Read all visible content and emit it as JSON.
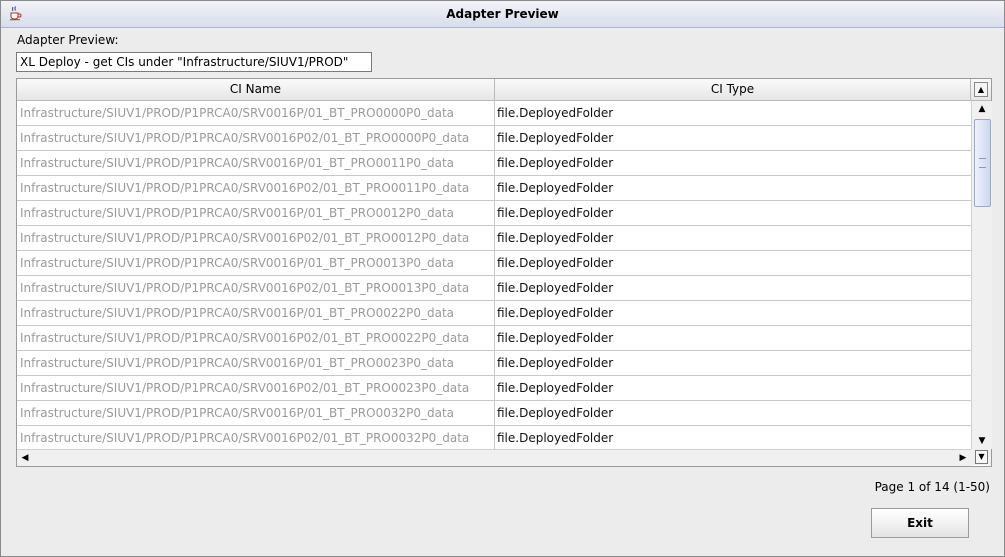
{
  "window": {
    "title": "Adapter Preview",
    "icon": "java-cup-icon"
  },
  "caption": "Adapter Preview:",
  "source_field": {
    "value": "XL Deploy - get CIs under \"Infrastructure/SIUV1/PROD\""
  },
  "table": {
    "columns": [
      "CI Name",
      "CI Type"
    ],
    "rows": [
      {
        "name": "Infrastructure/SIUV1/PROD/P1PRCA0/SRV0016P/01_BT_PRO0000P0_data",
        "type": "file.DeployedFolder"
      },
      {
        "name": "Infrastructure/SIUV1/PROD/P1PRCA0/SRV0016P02/01_BT_PRO0000P0_data",
        "type": "file.DeployedFolder"
      },
      {
        "name": "Infrastructure/SIUV1/PROD/P1PRCA0/SRV0016P/01_BT_PRO0011P0_data",
        "type": "file.DeployedFolder"
      },
      {
        "name": "Infrastructure/SIUV1/PROD/P1PRCA0/SRV0016P02/01_BT_PRO0011P0_data",
        "type": "file.DeployedFolder"
      },
      {
        "name": "Infrastructure/SIUV1/PROD/P1PRCA0/SRV0016P/01_BT_PRO0012P0_data",
        "type": "file.DeployedFolder"
      },
      {
        "name": "Infrastructure/SIUV1/PROD/P1PRCA0/SRV0016P02/01_BT_PRO0012P0_data",
        "type": "file.DeployedFolder"
      },
      {
        "name": "Infrastructure/SIUV1/PROD/P1PRCA0/SRV0016P/01_BT_PRO0013P0_data",
        "type": "file.DeployedFolder"
      },
      {
        "name": "Infrastructure/SIUV1/PROD/P1PRCA0/SRV0016P02/01_BT_PRO0013P0_data",
        "type": "file.DeployedFolder"
      },
      {
        "name": "Infrastructure/SIUV1/PROD/P1PRCA0/SRV0016P/01_BT_PRO0022P0_data",
        "type": "file.DeployedFolder"
      },
      {
        "name": "Infrastructure/SIUV1/PROD/P1PRCA0/SRV0016P02/01_BT_PRO0022P0_data",
        "type": "file.DeployedFolder"
      },
      {
        "name": "Infrastructure/SIUV1/PROD/P1PRCA0/SRV0016P/01_BT_PRO0023P0_data",
        "type": "file.DeployedFolder"
      },
      {
        "name": "Infrastructure/SIUV1/PROD/P1PRCA0/SRV0016P02/01_BT_PRO0023P0_data",
        "type": "file.DeployedFolder"
      },
      {
        "name": "Infrastructure/SIUV1/PROD/P1PRCA0/SRV0016P/01_BT_PRO0032P0_data",
        "type": "file.DeployedFolder"
      },
      {
        "name": "Infrastructure/SIUV1/PROD/P1PRCA0/SRV0016P02/01_BT_PRO0032P0_data",
        "type": "file.DeployedFolder"
      }
    ]
  },
  "scrollbar_icons": {
    "up": "up-arrow-icon",
    "down": "down-arrow-icon",
    "left": "left-arrow-icon",
    "right": "right-arrow-icon"
  },
  "pager": {
    "text": "Page 1 of 14 (1-50)"
  },
  "buttons": {
    "exit": "Exit"
  }
}
